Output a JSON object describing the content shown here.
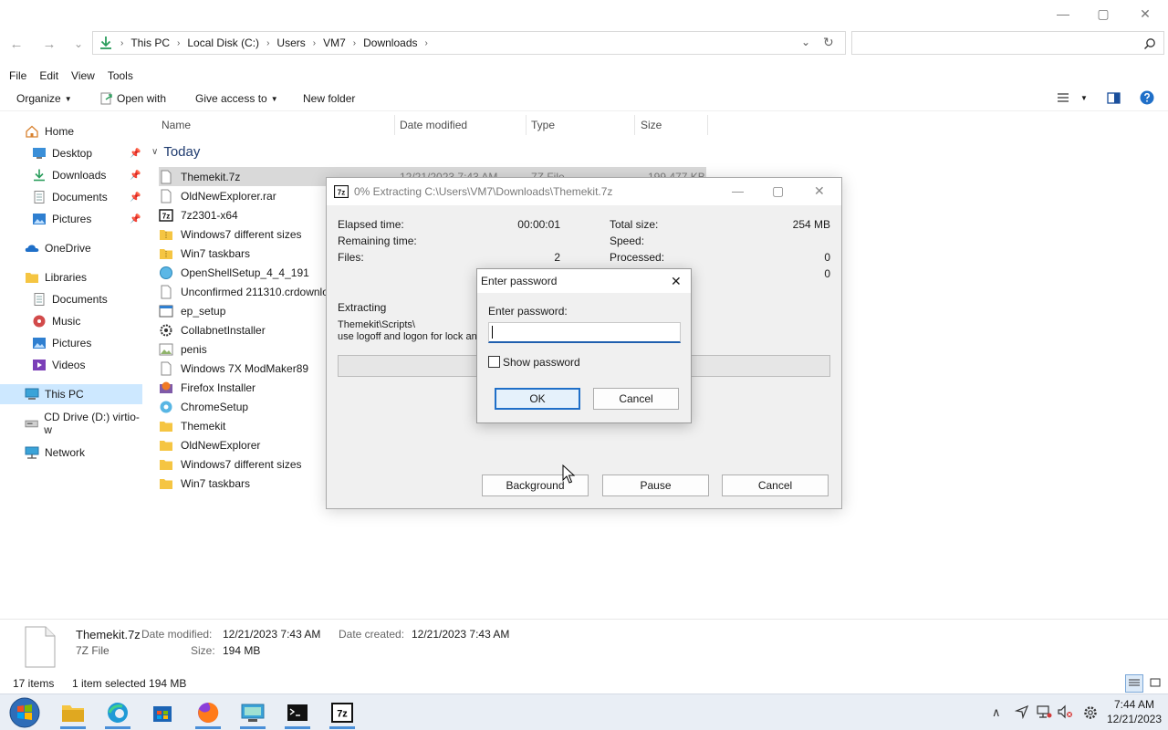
{
  "window": {
    "minimize": "—",
    "maximize": "▢",
    "close": "✕"
  },
  "nav": {
    "back": "←",
    "forward": "→",
    "recent": "⌄",
    "refresh": "↻",
    "dropdown": "⌄"
  },
  "address": {
    "crumbs": [
      "This PC",
      "Local Disk (C:)",
      "Users",
      "VM7",
      "Downloads"
    ]
  },
  "search": {
    "placeholder": ""
  },
  "menu": {
    "file": "File",
    "edit": "Edit",
    "view": "View",
    "tools": "Tools"
  },
  "toolbar": {
    "organize": "Organize",
    "open_with": "Open with",
    "give_access": "Give access to",
    "new_folder": "New folder"
  },
  "sidebar": {
    "items": [
      {
        "label": "Home"
      },
      {
        "label": "Desktop"
      },
      {
        "label": "Downloads"
      },
      {
        "label": "Documents"
      },
      {
        "label": "Pictures"
      },
      {
        "label": "OneDrive"
      },
      {
        "label": "Libraries"
      },
      {
        "label": "Documents"
      },
      {
        "label": "Music"
      },
      {
        "label": "Pictures"
      },
      {
        "label": "Videos"
      },
      {
        "label": "This PC"
      },
      {
        "label": "CD Drive (D:) virtio-w"
      },
      {
        "label": "Network"
      }
    ]
  },
  "columns": {
    "name": "Name",
    "date": "Date modified",
    "type": "Type",
    "size": "Size"
  },
  "group": {
    "label": "Today"
  },
  "files": [
    {
      "name": "Themekit.7z",
      "date": "12/21/2023 7:43 AM",
      "type": "7Z File",
      "size": "199,477 KB"
    },
    {
      "name": "OldNewExplorer.rar"
    },
    {
      "name": "7z2301-x64"
    },
    {
      "name": "Windows7 different sizes"
    },
    {
      "name": "Win7 taskbars"
    },
    {
      "name": "OpenShellSetup_4_4_191"
    },
    {
      "name": "Unconfirmed 211310.crdownlo"
    },
    {
      "name": "ep_setup"
    },
    {
      "name": "CollabnetInstaller"
    },
    {
      "name": "penis"
    },
    {
      "name": "Windows 7X ModMaker89"
    },
    {
      "name": "Firefox Installer"
    },
    {
      "name": "ChromeSetup"
    },
    {
      "name": "Themekit"
    },
    {
      "name": "OldNewExplorer"
    },
    {
      "name": "Windows7 different sizes"
    },
    {
      "name": "Win7 taskbars"
    }
  ],
  "details": {
    "filename": "Themekit.7z",
    "filetype": "7Z File",
    "date_modified_label": "Date modified:",
    "date_modified": "12/21/2023 7:43 AM",
    "date_created_label": "Date created:",
    "date_created": "12/21/2023 7:43 AM",
    "size_label": "Size:",
    "size": "194 MB"
  },
  "status": {
    "items": "17 items",
    "selected": "1 item selected  194 MB"
  },
  "zip": {
    "title": "0% Extracting C:\\Users\\VM7\\Downloads\\Themekit.7z",
    "elapsed_label": "Elapsed time:",
    "elapsed": "00:00:01",
    "remaining_label": "Remaining time:",
    "files_label": "Files:",
    "files": "2",
    "total_size_label": "Total size:",
    "total_size": "254 MB",
    "speed_label": "Speed:",
    "processed_label": "Processed:",
    "processed": "0",
    "row4": "0",
    "extracting_label": "Extracting",
    "current_path": "Themekit\\Scripts\\",
    "current_file": "use logoff and logon for lock and",
    "progress": 0,
    "background": "Background",
    "pause": "Pause",
    "cancel": "Cancel"
  },
  "password": {
    "title": "Enter password",
    "label": "Enter password:",
    "value": "",
    "show_label": "Show password",
    "ok": "OK",
    "cancel": "Cancel"
  },
  "clock": {
    "time": "7:44 AM",
    "date": "12/21/2023"
  },
  "colors": {
    "accent": "#0078d4",
    "selected_nav": "#cde8ff",
    "folder": "#f5c542"
  }
}
